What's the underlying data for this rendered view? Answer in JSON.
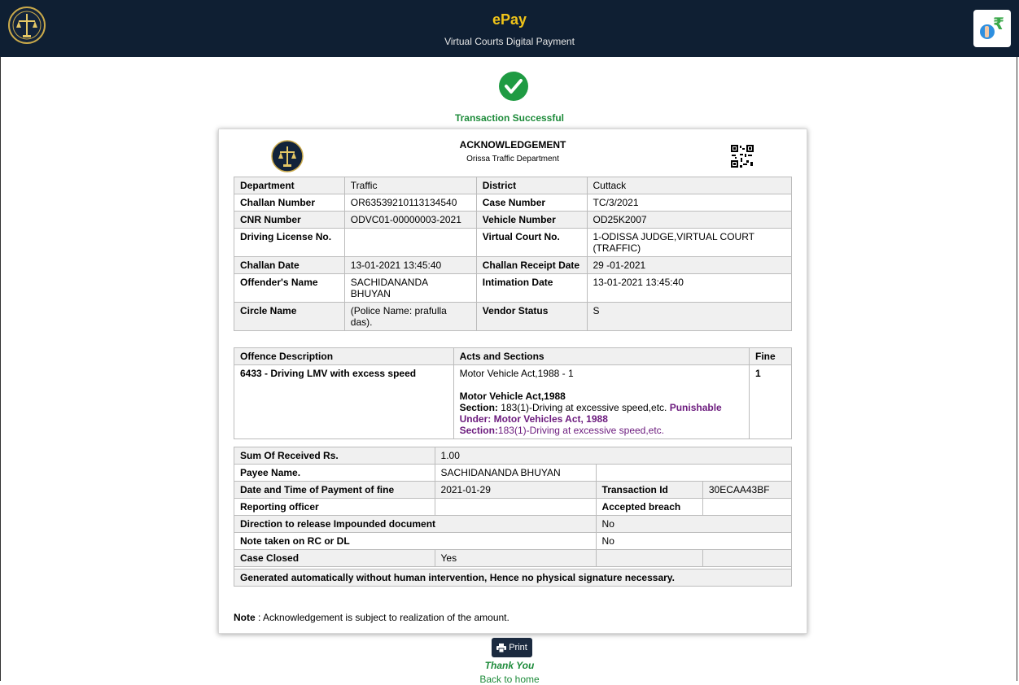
{
  "header": {
    "title": "ePay",
    "subtitle": "Virtual Courts Digital Payment",
    "logo_icon": "emblem-icon",
    "pay_icon": "rupee-pay-icon"
  },
  "status": {
    "message": "Transaction Successful",
    "icon": "check-circle-icon",
    "color": "#1d8b3a"
  },
  "ack": {
    "title": "ACKNOWLEDGEMENT",
    "subtitle": "Orissa Traffic Department",
    "details": [
      [
        "Department",
        "Traffic",
        "District",
        "Cuttack"
      ],
      [
        "Challan Number",
        "OR63539210113134540",
        "Case Number",
        "TC/3/2021"
      ],
      [
        "CNR Number",
        "ODVC01-00000003-2021",
        "Vehicle Number",
        "OD25K2007"
      ],
      [
        "Driving License No.",
        "",
        "Virtual Court No.",
        "1-ODISSA JUDGE,VIRTUAL COURT (TRAFFIC)"
      ],
      [
        "Challan Date",
        "13-01-2021 13:45:40",
        "Challan Receipt Date",
        "29 -01-2021"
      ],
      [
        "Offender's Name",
        "SACHIDANANDA BHUYAN",
        "Intimation Date",
        "13-01-2021 13:45:40"
      ],
      [
        "Circle Name",
        "(Police Name: prafulla das).",
        "Vendor Status",
        "S"
      ]
    ],
    "offence": {
      "headers": [
        "Offence Description",
        "Acts and Sections",
        "Fine"
      ],
      "description": "6433 - Driving LMV with excess speed",
      "act_line": "Motor Vehicle Act,1988 - 1",
      "act_name": "Motor Vehicle Act,1988",
      "section_label": "Section:",
      "section_text": "183(1)-Driving at excessive speed,etc.",
      "punishable_label": "Punishable Under:",
      "punishable_act": "Motor Vehicles Act, 1988",
      "section2_label": "Section:",
      "section2_text": "183(1)-Driving at excessive speed,etc.",
      "fine": "1"
    },
    "payment": {
      "sum_label": "Sum Of Received Rs.",
      "sum_value": "1.00",
      "payee_label": "Payee Name.",
      "payee_value": "SACHIDANANDA BHUYAN",
      "date_label": "Date and Time of Payment of fine",
      "date_value": "2021-01-29",
      "txn_label": "Transaction Id",
      "txn_value": "30ECAA43BF",
      "officer_label": "Reporting officer",
      "officer_value": "",
      "breach_label": "Accepted breach",
      "breach_value": "",
      "release_label": "Direction to release Impounded document",
      "release_value": "No",
      "note_rc_label": "Note taken on RC or DL",
      "note_rc_value": "No",
      "closed_label": "Case Closed",
      "closed_value": "Yes",
      "auto_text": "Generated automatically without human intervention, Hence no physical signature necessary."
    },
    "note_label": "Note",
    "note_text": " : Acknowledgement is subject to realization of the amount."
  },
  "footer": {
    "print_label": "Print",
    "print_icon": "printer-icon",
    "thanks": "Thank You",
    "back_link": "Back to home"
  }
}
